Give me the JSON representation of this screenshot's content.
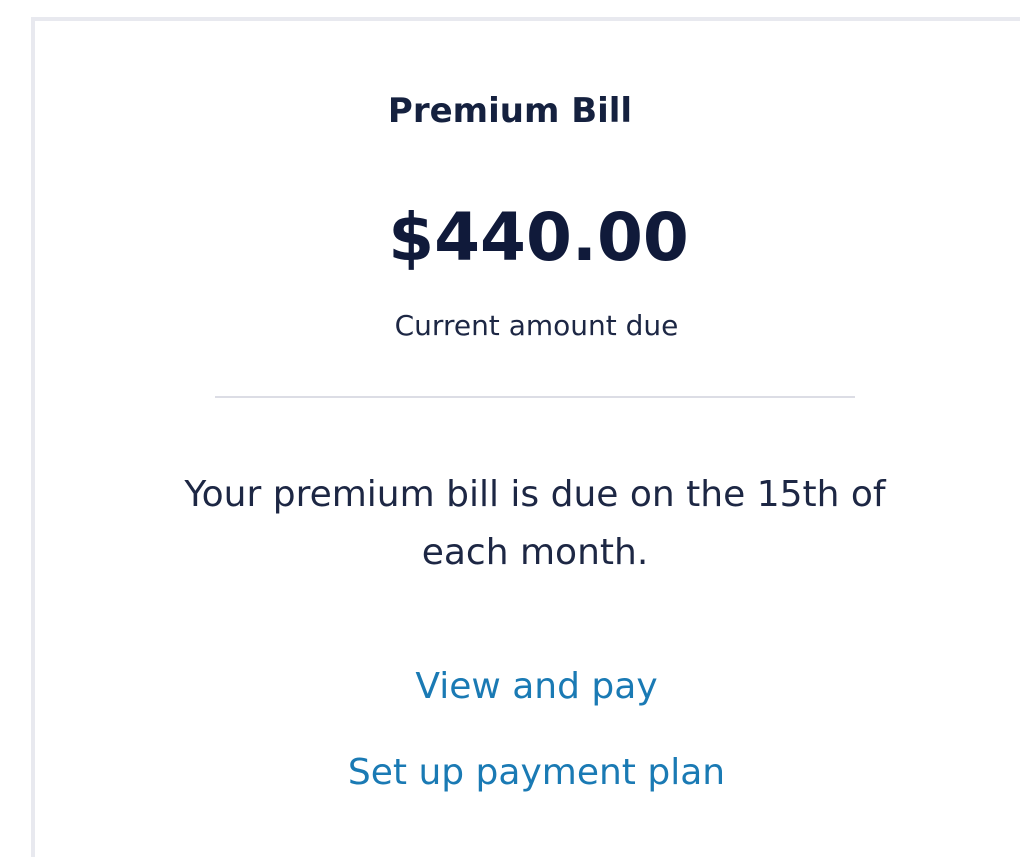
{
  "bill_card": {
    "title": "Premium Bill",
    "amount": "$440.00",
    "amount_label": "Current amount due",
    "due_note": "Your premium bill is due on the 15th of each month.",
    "actions": {
      "view_and_pay": "View and pay",
      "set_up_payment_plan": "Set up payment plan"
    }
  },
  "colors": {
    "heading_text": "#15213f",
    "body_text": "#1d2744",
    "link": "#1a7ab4",
    "card_border": "#e8e9ef",
    "divider": "#dcdde5"
  }
}
